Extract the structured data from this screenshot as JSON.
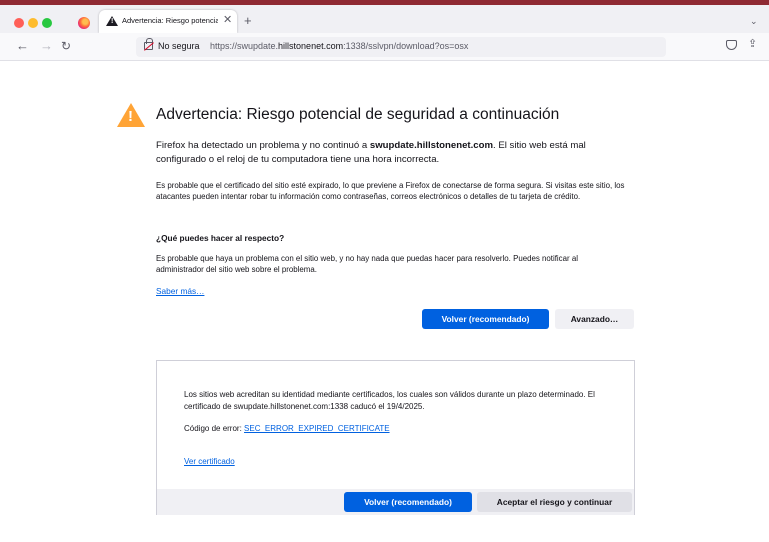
{
  "browser": {
    "tab_title": "Advertencia: Riesgo potencial d",
    "tab_close_glyph": "✕",
    "new_tab_glyph": "+",
    "tab_list_glyph": "⌄",
    "back_glyph": "←",
    "forward_glyph": "→",
    "reload_glyph": "↻",
    "security_label": "No segura",
    "url_prefix": "https://swupdate.",
    "url_domain": "hillstonenet.com",
    "url_suffix": ":1338/sslvpn/download?os=osx",
    "bookmark_glyph": "☆",
    "share_glyph": "⇪"
  },
  "page": {
    "title": "Advertencia: Riesgo potencial de seguridad a continuación",
    "p1_before": "Firefox ha detectado un problema y no continuó a ",
    "p1_host": "swupdate.hillstonenet.com",
    "p1_after": ". El sitio web está mal configurado o el reloj de tu computadora tiene una hora incorrecta.",
    "p2": "Es probable que el certificado del sitio esté expirado, lo que previene a Firefox de conectarse de forma segura. Si visitas este sitio, los atacantes pueden intentar robar tu información como contraseñas, correos electrónicos o detalles de tu tarjeta de crédito.",
    "what_heading": "¿Qué puedes hacer al respecto?",
    "p3": "Es probable que haya un problema con el sitio web, y no hay nada que puedas hacer para resolverlo. Puedes notificar al administrador del sitio web sobre el problema.",
    "learn_more": "Saber más…",
    "go_back_label": "Volver (recomendado)",
    "advanced_label": "Avanzado…"
  },
  "advanced": {
    "text": "Los sitios web acreditan su identidad mediante certificados, los cuales son válidos durante un plazo determinado. El certificado de swupdate.hillstonenet.com:1338 caducó el 19/4/2025.",
    "error_label": "Código de error: ",
    "error_code": "SEC_ERROR_EXPIRED_CERTIFICATE",
    "view_cert": "Ver certificado",
    "go_back_label": "Volver (recomendado)",
    "accept_label": "Aceptar el riesgo y continuar"
  },
  "colors": {
    "accent": "#0061e0",
    "warning": "#ffa436",
    "top_strip": "#8f2a33"
  }
}
